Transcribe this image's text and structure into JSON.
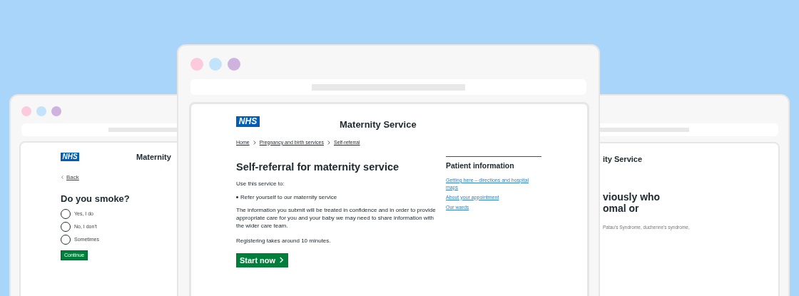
{
  "left_window": {
    "logo": "NHS",
    "service_title": "Maternity",
    "back_link": "Back",
    "question": "Do you smoke?",
    "options": [
      {
        "label": "Yes, I do",
        "selected": false
      },
      {
        "label": "No, I don't",
        "selected": false
      },
      {
        "label": "Sometimes",
        "selected": false
      }
    ],
    "button": "Continue"
  },
  "main_window": {
    "logo": "NHS",
    "service_title": "Maternity Service",
    "breadcrumbs": [
      "Home",
      "Pregnancy and birth services",
      "Self-referral"
    ],
    "heading": "Self-referral for maternity service",
    "intro": "Use this service to:",
    "bullets": [
      "Refer yourself to our maternity service"
    ],
    "paragraphs": [
      "The information you submit will be treated in confidence and in order to provide appropriate care for you and your baby we may need to share information with the wider care team.",
      "Registering takes around 10 minutes."
    ],
    "button": "Start now",
    "sidebar": {
      "title": "Patient information",
      "links": [
        "Getting here – directions and hospital maps",
        "About your appointment",
        "Our wards"
      ]
    }
  },
  "right_window": {
    "service_title": "ity Service",
    "heading_lines": [
      "viously who",
      "omal or"
    ],
    "hint": "Patau's Syndrome, duchenne's syndrome,"
  }
}
